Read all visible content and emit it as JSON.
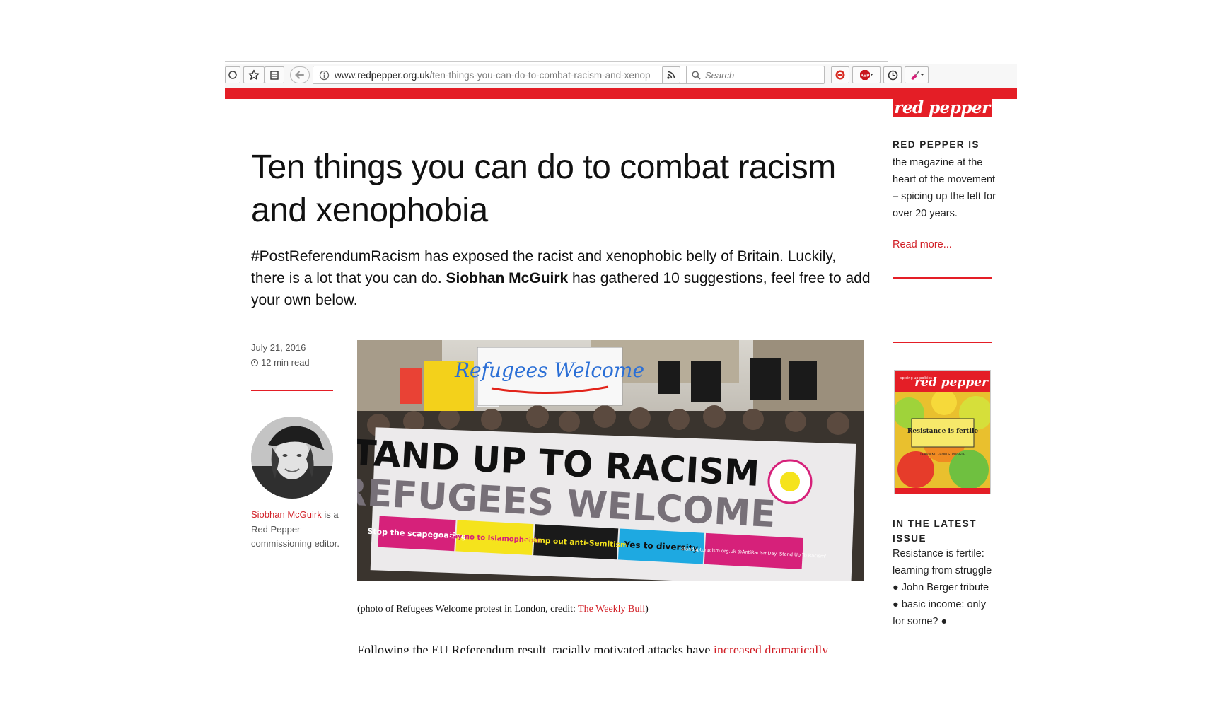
{
  "browser": {
    "url_domain": "www.redpepper.org.uk",
    "url_path": "/ten-things-you-can-do-to-combat-racism-and-xenophc",
    "search_placeholder": "Search"
  },
  "site": {
    "logo_text": "red pepper"
  },
  "article": {
    "title": "Ten things you can do to combat racism and xenophobia",
    "standfirst_part1": "#PostReferendumRacism has exposed the racist and xenophobic belly of Britain. Luckily, there is a lot that you can do.",
    "standfirst_author": "Siobhan McGuirk",
    "standfirst_part2": "has gathered 10 suggestions, feel free to add your own below.",
    "date": "July 21, 2016",
    "read_time": "12 min read",
    "author_name": "Siobhan McGuirk",
    "author_bio": "is a Red Pepper commissioning editor.",
    "caption_prefix": "(photo of Refugees Welcome protest in London, credit: ",
    "caption_link": "The Weekly Bull",
    "caption_suffix": ")",
    "body_start": "Following the EU Referendum result, racially motivated attacks have ",
    "body_link": "increased dramatically"
  },
  "hero_image": {
    "sign_top": "Refugees Welcome",
    "banner_line1": "STAND UP TO RACISM",
    "banner_line2": "REFUGEES WELCOME",
    "panels": [
      {
        "text": "Stop the scapegoating",
        "color": "#d6217a"
      },
      {
        "text": "Say no to Islamophobia",
        "color": "#f5e31c"
      },
      {
        "text": "Stamp out anti-Semitism",
        "color": "#1a1a1a"
      },
      {
        "text": "Yes to diversity",
        "color": "#1ea9e1"
      },
      {
        "text": "standuptoracism.org.uk @AntiRacismDay 'Stand Up To Racism'",
        "color": "#d6217a"
      }
    ],
    "badge": "STAND UP TO RACISM"
  },
  "sidebar": {
    "heading": "RED PEPPER IS",
    "text": "the magazine at the heart of the movement – spicing up the left for over 20 years.",
    "read_more": "Read more...",
    "cover_title": "red pepper",
    "cover_tag": "spicing up politics",
    "cover_headline": "Resistance is fertile",
    "cover_sub": "LEARNING FROM STRUGGLE",
    "latest_heading": "IN THE LATEST ISSUE",
    "latest_text": "Resistance is fertile: learning from struggle ● John Berger tribute ● basic income: only for some? ●"
  },
  "colors": {
    "brand_red": "#e41e26",
    "link_red": "#d11f26"
  }
}
